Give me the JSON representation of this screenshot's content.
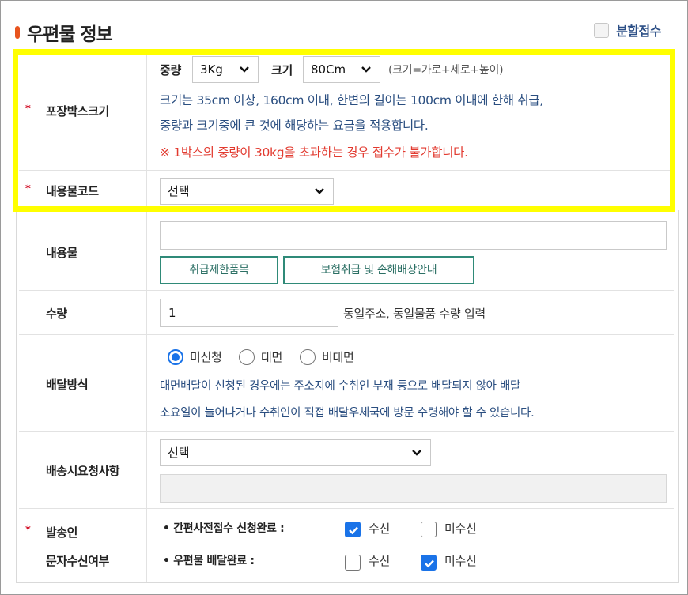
{
  "header": {
    "title": "우편물 정보",
    "split_label": "분할접수",
    "split_checked": false
  },
  "rows": {
    "box_size": {
      "required_mark": "*",
      "label": "포장박스크기",
      "weight_label": "중량",
      "weight_value": "3Kg",
      "size_label": "크기",
      "size_value": "80Cm",
      "size_formula": "(크기=가로+세로+높이)",
      "desc_line1": "크기는 35cm 이상, 160cm 이내, 한변의 길이는 100cm 이내에 한해 취급,",
      "desc_line2": "중량과 크기중에 큰 것에 해당하는 요금을 적용합니다.",
      "warning": "※ 1박스의 중량이 30kg을 초과하는 경우 접수가 불가합니다."
    },
    "content_code": {
      "required_mark": "*",
      "label": "내용물코드",
      "select_value": "선택"
    },
    "contents": {
      "label": "내용물",
      "input_value": "",
      "btn_restricted": "취급제한품목",
      "btn_insurance": "보험취급 및 손해배상안내"
    },
    "quantity": {
      "label": "수량",
      "input_value": "1",
      "note": "동일주소, 동일물품 수량 입력"
    },
    "delivery": {
      "label": "배달방식",
      "options": [
        "미신청",
        "대면",
        "비대면"
      ],
      "selected": "미신청",
      "desc_line1": "대면배달이 신청된 경우에는 주소지에 수취인 부재 등으로 배달되지 않아 배달",
      "desc_line2": "소요일이 늘어나거나 수취인이 직접 배달우체국에 방문 수령해야 할 수 있습니다."
    },
    "request": {
      "label": "배송시요청사항",
      "select_value": "선택",
      "input_value": ""
    },
    "sms": {
      "required_mark": "*",
      "label_line1": "발송인",
      "label_line2": "문자수신여부",
      "item1_label": "• 간편사전접수 신청완료 :",
      "item2_label": "• 우편물 배달완료 :",
      "receive": "수신",
      "not_receive": "미수신"
    }
  },
  "colors": {
    "accent": "#1a73e8",
    "highlight": "#ffff00",
    "title_bar": "#e8541e",
    "button_border": "#2f8a78",
    "warning": "#e23a2f"
  }
}
